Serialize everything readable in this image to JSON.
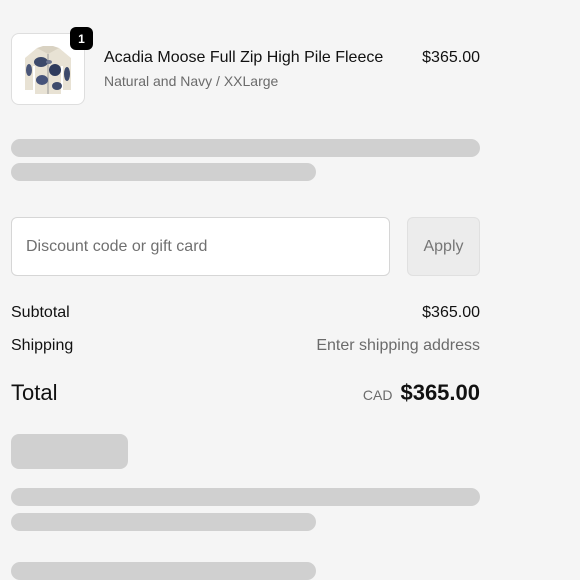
{
  "product": {
    "quantity": "1",
    "title": "Acadia Moose Full Zip High Pile Fleece",
    "variant": "Natural and Navy / XXLarge",
    "price": "$365.00"
  },
  "discount": {
    "placeholder": "Discount code or gift card",
    "apply_label": "Apply"
  },
  "summary": {
    "subtotal_label": "Subtotal",
    "subtotal_value": "$365.00",
    "shipping_label": "Shipping",
    "shipping_value": "Enter shipping address",
    "total_label": "Total",
    "currency": "CAD",
    "total_value": "$365.00"
  },
  "colors": {
    "background": "#f5f5f5",
    "skeleton": "#d0d0d0",
    "badge": "#000000"
  }
}
